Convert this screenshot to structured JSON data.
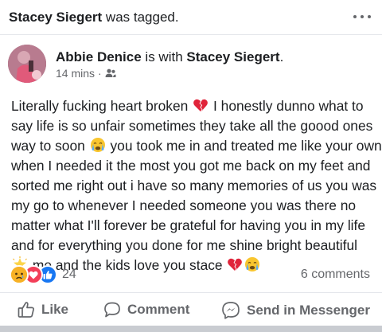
{
  "header": {
    "tagged_name": "Stacey Siegert",
    "tagged_suffix": " was tagged."
  },
  "post": {
    "author": "Abbie Denice",
    "with_text": " is with ",
    "with_name": "Stacey Siegert",
    "with_period": ".",
    "time": "14 mins",
    "privacy_icon": "friends-icon",
    "body_lines": [
      [
        "Literally fucking heart broken ",
        " I honestly dunno what to"
      ],
      [
        "say life is so unfair sometimes they take all the goood ones"
      ],
      [
        "way to soon ",
        " you took me in and treated me like your own"
      ],
      [
        "when I needed it the most you got me back on my feet and"
      ],
      [
        "sorted me right out i have so many memories of us you was"
      ],
      [
        "my go to whenever I needed someone you was there no"
      ],
      [
        "matter what I'll forever be grateful for having you in my life"
      ],
      [
        "and for everything you done for me shine bright beautiful"
      ],
      [
        "",
        " me and the kids love you stace "
      ]
    ],
    "emojis": [
      "broken-heart",
      "crying-face",
      "glowing-star",
      "broken-heart",
      "crying-face"
    ]
  },
  "reactions": {
    "types": [
      "sad",
      "love",
      "like"
    ],
    "count": "24",
    "comments": "6 comments"
  },
  "actions": {
    "like": "Like",
    "comment": "Comment",
    "send": "Send in Messenger"
  },
  "colors": {
    "text": "#1c1e21",
    "secondary": "#65676b",
    "like_blue": "#1877f2",
    "love_red": "#f33e58",
    "sad_yellow": "#f7b125"
  }
}
